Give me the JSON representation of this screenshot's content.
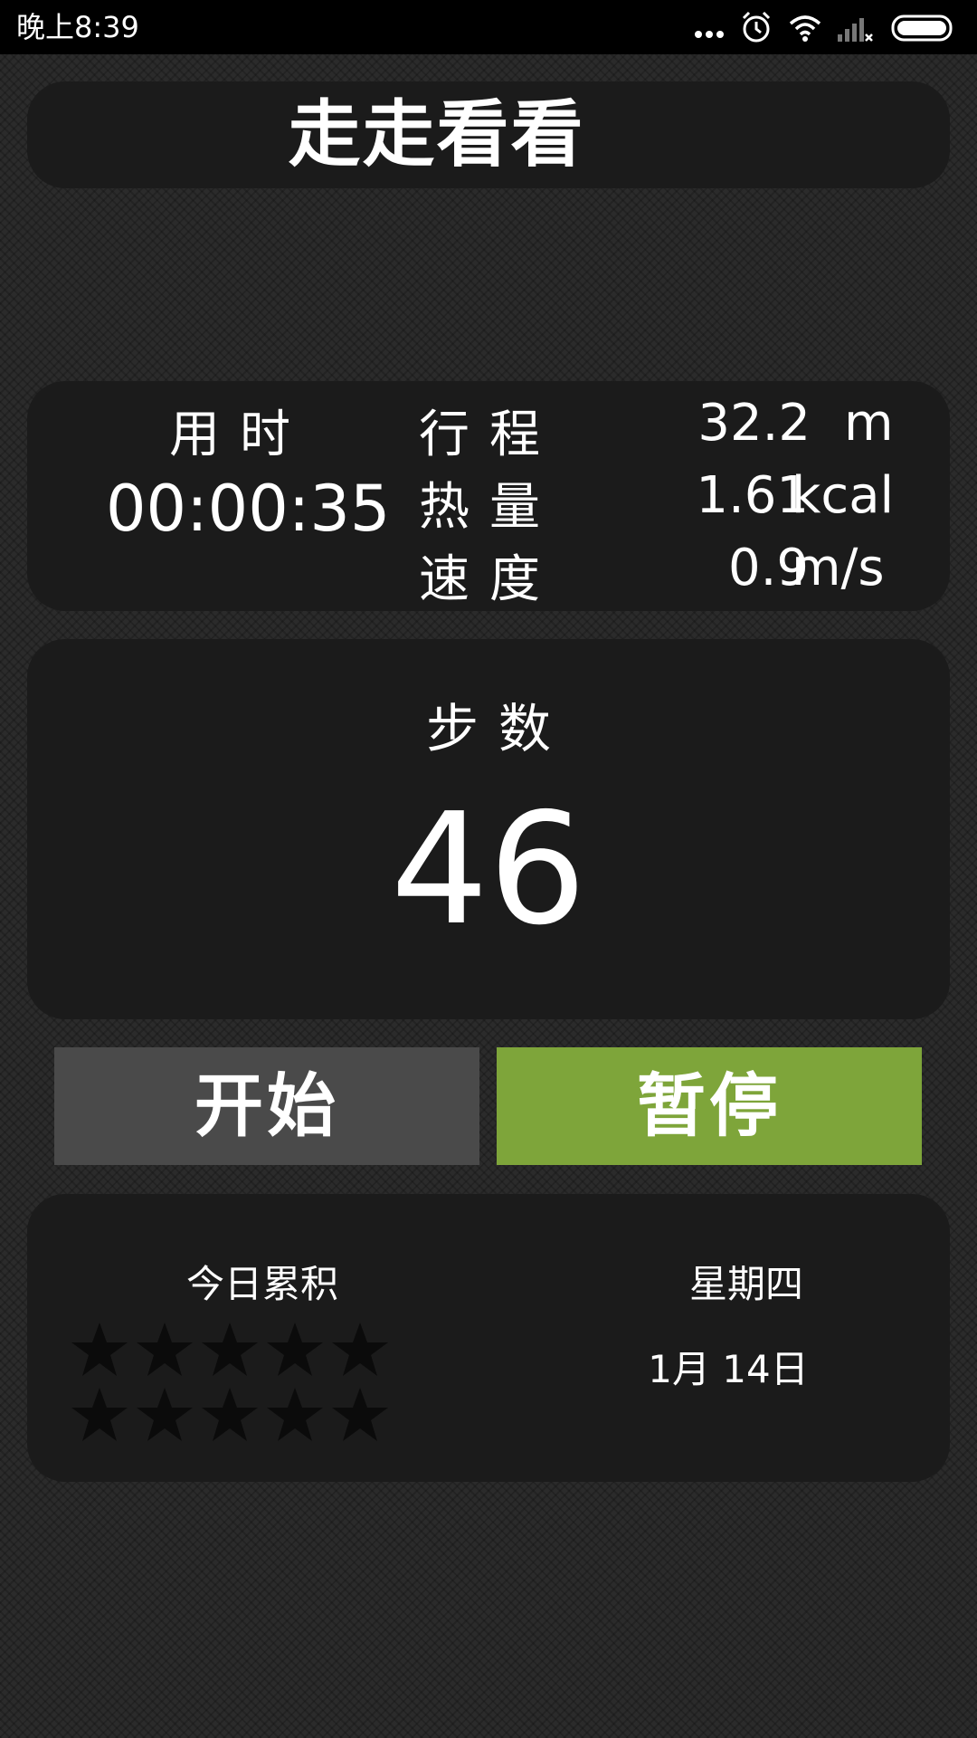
{
  "status_bar": {
    "time": "晚上8:39",
    "icons": [
      "more-dots-icon",
      "alarm-icon",
      "wifi-icon",
      "signal-icon",
      "battery-icon"
    ]
  },
  "app": {
    "title": "走走看看"
  },
  "stats": {
    "duration_label": "用时",
    "duration_value": "00:00:35",
    "distance_label": "行程",
    "distance_value": "32.2",
    "distance_unit": "m",
    "calories_label": "热量",
    "calories_value": "1.61",
    "calories_unit": "kcal",
    "speed_label": "速度",
    "speed_value": "0.9",
    "speed_unit": "m/s"
  },
  "steps": {
    "label": "步数",
    "value": "46"
  },
  "buttons": {
    "start_label": "开始",
    "pause_label": "暂停"
  },
  "summary": {
    "cumulative_label": "今日累积",
    "stars_filled": 0,
    "stars_total": 10,
    "weekday": "星期四",
    "date": "1月 14日"
  },
  "colors": {
    "background": "#2b2b2b",
    "panel": "#1b1b1b",
    "status_bar": "#000000",
    "start_button": "#4a4a4a",
    "pause_button": "#7ea53a",
    "star_empty": "#0b0b0b"
  }
}
